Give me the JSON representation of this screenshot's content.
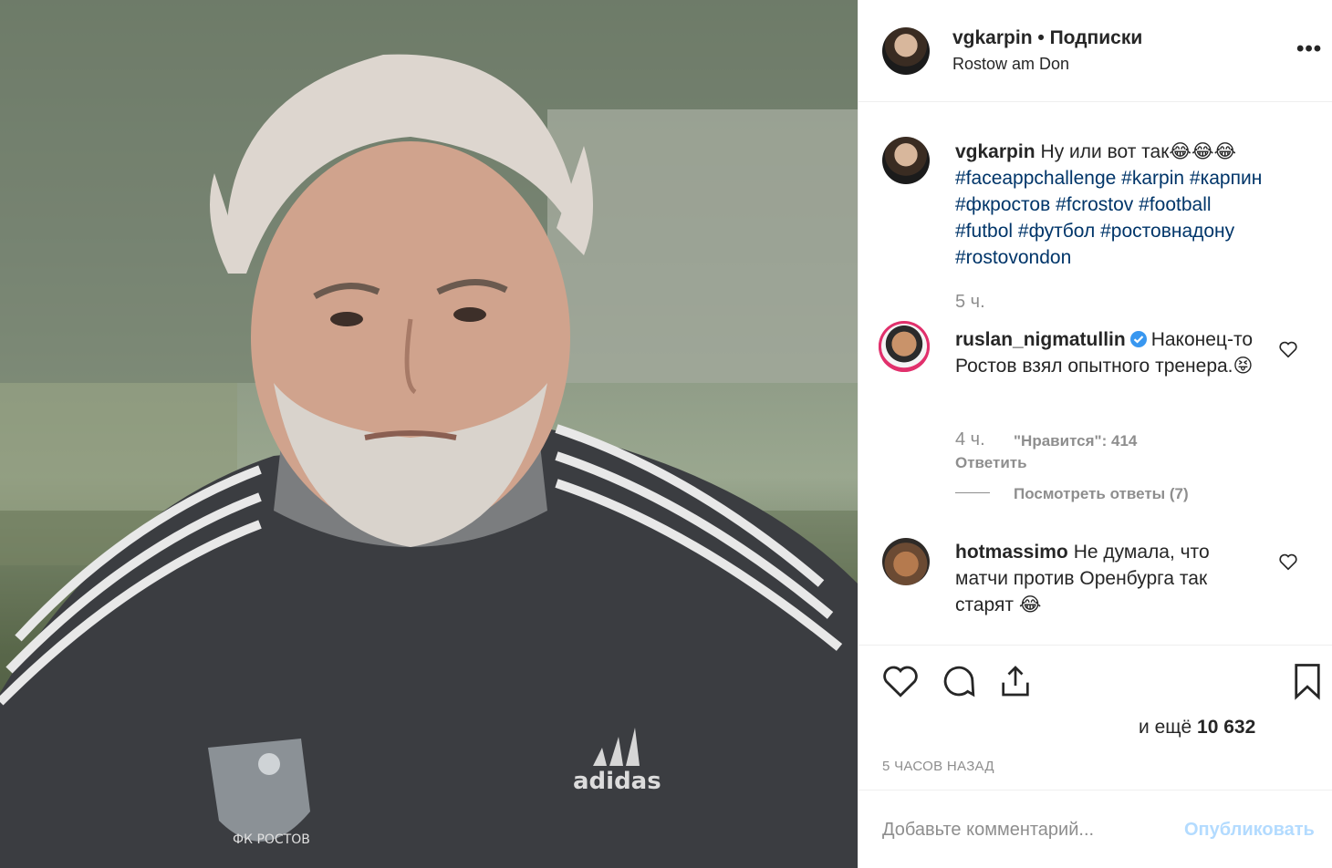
{
  "photo": {
    "shirt_brand": "adidas",
    "crest_text": "ФК РОСТОВ"
  },
  "header": {
    "username": "vgkarpin",
    "separator": "•",
    "follow_label": "Подписки",
    "location": "Rostow am Don",
    "more_label": "•••"
  },
  "caption": {
    "username": "vgkarpin",
    "text": "Ну или вот так😂😂😂",
    "hashtags": [
      "#faceappchallenge",
      "#karpin",
      "#карпин",
      "#фкростов",
      "#fcrostov",
      "#football",
      "#futbol",
      "#футбол",
      "#ростовнадону",
      "#rostovondon"
    ],
    "time": "5 ч."
  },
  "comments": [
    {
      "username": "ruslan_nigmatullin",
      "verified": true,
      "text": "Наконец-то Ростов взял опытного тренера.😝",
      "time": "4 ч.",
      "likes": "\"Нравится\": 414",
      "reply_label": "Ответить",
      "view_replies": "Посмотреть ответы (7)"
    },
    {
      "username": "hotmassimo",
      "verified": false,
      "text": "Не думала, что матчи против Оренбурга так старят 😂"
    }
  ],
  "actions": {
    "like_icon": "heart-icon",
    "comment_icon": "comment-icon",
    "share_icon": "share-icon",
    "save_icon": "bookmark-icon",
    "likes_prefix": "и ещё",
    "likes_count": "10 632",
    "posted_ago": "5 ЧАСОВ НАЗАД"
  },
  "add_comment": {
    "placeholder": "Добавьте комментарий...",
    "publish_label": "Опубликовать"
  },
  "colors": {
    "hashtag": "#003569",
    "muted": "#8e8e8e",
    "publish_disabled": "#b3dbff",
    "verified": "#3897f0"
  }
}
